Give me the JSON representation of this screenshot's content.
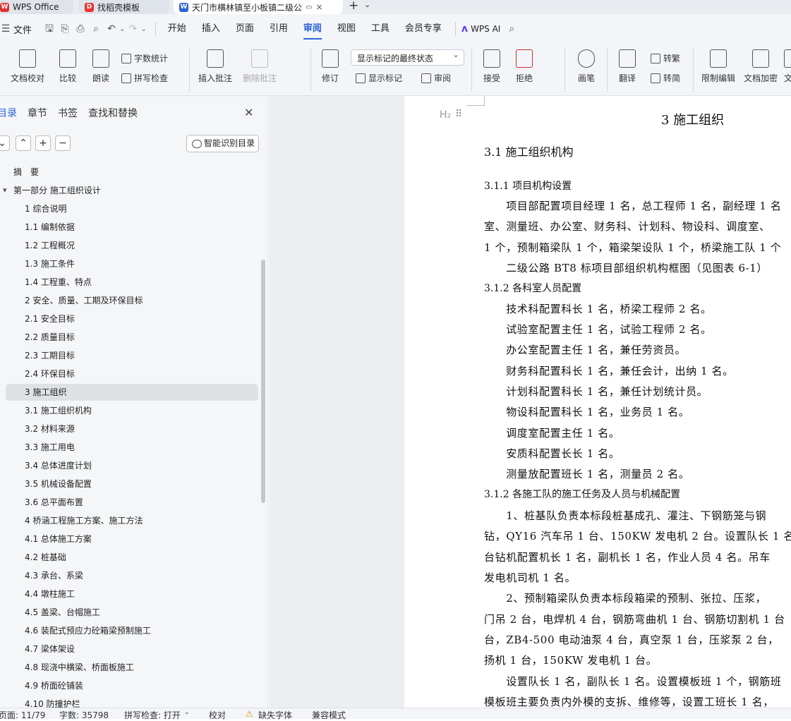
{
  "tabs": [
    {
      "label": "WPS Office"
    },
    {
      "label": "找稻壳模板"
    },
    {
      "label": "天门市横林镇至小板镇二级公"
    }
  ],
  "menu": {
    "file": "文件",
    "items": [
      "开始",
      "插入",
      "页面",
      "引用",
      "审阅",
      "视图",
      "工具",
      "会员专享"
    ],
    "active": "审阅",
    "ai": "WPS AI"
  },
  "ribbon": {
    "doc_check": "文档校对",
    "compare": "比较",
    "read_aloud": "朗读",
    "word_count": "字数统计",
    "spell_check": "拼写检查",
    "insert_comment": "插入批注",
    "delete_comment": "删除批注",
    "revise": "修订",
    "display_state": "显示标记的最终状态",
    "show_marks": "显示标记",
    "review": "审阅",
    "accept": "接受",
    "reject": "拒绝",
    "pen": "画笔",
    "translate": "翻译",
    "to_trad": "转繁",
    "to_simp": "转简",
    "restrict_edit": "限制编辑",
    "encrypt": "文档加密",
    "more": "文"
  },
  "nav": {
    "tabs": [
      "目录",
      "章节",
      "书签",
      "查找和替换"
    ],
    "smart_toc": "智能识别目录",
    "items": [
      {
        "label": "摘　要",
        "level": 0
      },
      {
        "label": "第一部分 施工组织设计",
        "level": 0
      },
      {
        "label": "1 综合说明",
        "level": 1
      },
      {
        "label": "1.1 编制依据",
        "level": 1
      },
      {
        "label": "1.2 工程概况",
        "level": 1
      },
      {
        "label": "1.3 施工条件",
        "level": 1
      },
      {
        "label": "1.4 工程重、特点",
        "level": 1
      },
      {
        "label": "2 安全、质量、工期及环保目标",
        "level": 1
      },
      {
        "label": "2.1 安全目标",
        "level": 1
      },
      {
        "label": "2.2 质量目标",
        "level": 1
      },
      {
        "label": "2.3 工期目标",
        "level": 1
      },
      {
        "label": "2.4 环保目标",
        "level": 1
      },
      {
        "label": "3 施工组织",
        "level": 1
      },
      {
        "label": "3.1 施工组织机构",
        "level": 1
      },
      {
        "label": "3.2 材料来源",
        "level": 1
      },
      {
        "label": "3.3 施工用电",
        "level": 1
      },
      {
        "label": "3.4 总体进度计划",
        "level": 1
      },
      {
        "label": "3.5 机械设备配置",
        "level": 1
      },
      {
        "label": "3.6 总平面布置",
        "level": 1
      },
      {
        "label": "4 桥涵工程施工方案、施工方法",
        "level": 1
      },
      {
        "label": "4.1 总体施工方案",
        "level": 1
      },
      {
        "label": "4.2 桩基础",
        "level": 1
      },
      {
        "label": "4.3 承台、系梁",
        "level": 1
      },
      {
        "label": "4.4 墩柱施工",
        "level": 1
      },
      {
        "label": "4.5 盖梁、台帽施工",
        "level": 1
      },
      {
        "label": "4.6 装配式预应力砼箱梁预制施工",
        "level": 1
      },
      {
        "label": "4.7 梁体架设",
        "level": 1
      },
      {
        "label": "4.8 现浇中横梁、桥面板施工",
        "level": 1
      },
      {
        "label": "4.9 桥面砼铺装",
        "level": 1
      },
      {
        "label": "4.10 防撞护栏",
        "level": 1
      }
    ],
    "selected": "3 施工组织"
  },
  "doc": {
    "heading_marker": "H₂",
    "lines": [
      {
        "text": "3  施工组织",
        "cls": "h1"
      },
      {
        "text": "3.1  施工组织机构",
        "cls": "h2"
      },
      {
        "text": "3.1.1  项目机构设置",
        "cls": "h3"
      },
      {
        "text": "　　项目部配置项目经理 1 名，总工程师 1 名，副经理 1 名",
        "cls": "p"
      },
      {
        "text": "室、测量班、办公室、财务科、计划科、物设科、调度室、",
        "cls": "p"
      },
      {
        "text": "1 个，预制箱梁队 1 个，箱梁架设队 1 个，桥梁施工队 1 个",
        "cls": "p"
      },
      {
        "text": "　　二级公路 BT8 标项目部组织机构框图（见图表 6-1）",
        "cls": "p"
      },
      {
        "text": "3.1.2  各科室人员配置",
        "cls": "h3"
      },
      {
        "text": "　　技术科配置科长 1 名，桥梁工程师 2 名。",
        "cls": "p"
      },
      {
        "text": "　　试验室配置主任 1 名，试验工程师 2 名。",
        "cls": "p"
      },
      {
        "text": "　　办公室配置主任 1 名，兼任劳资员。",
        "cls": "p"
      },
      {
        "text": "　　财务科配置科长 1 名，兼任会计，出纳 1 名。",
        "cls": "p"
      },
      {
        "text": "　　计划科配置科长 1 名，兼任计划统计员。",
        "cls": "p"
      },
      {
        "text": "　　物设科配置科长 1 名，业务员 1 名。",
        "cls": "p"
      },
      {
        "text": "　　调度室配置主任 1 名。",
        "cls": "p"
      },
      {
        "text": "　　安质科配置长长 1 名。",
        "cls": "p"
      },
      {
        "text": "　　测量放配置班长 1 名，测量员 2 名。",
        "cls": "p"
      },
      {
        "text": "3.1.2  各施工队的施工任务及人员与机械配置",
        "cls": "h3"
      },
      {
        "text": "　　1、桩基队负责本标段桩基成孔、灌注、下钢筋笼与钢",
        "cls": "p"
      },
      {
        "text": "钻，QY16 汽车吊 1 台、150KW 发电机 2 台。设置队长 1 名",
        "cls": "p"
      },
      {
        "text": "台钻机配置机长 1 名，副机长 1 名，作业人员 4 名。吊车",
        "cls": "p"
      },
      {
        "text": "发电机司机 1 名。",
        "cls": "p"
      },
      {
        "text": "　　2、预制箱梁队负责本标段箱梁的预制、张拉、压浆，",
        "cls": "p"
      },
      {
        "text": "门吊 2 台，电焊机 4 台，钢筋弯曲机 1 台、钢筋切割机 1 台",
        "cls": "p"
      },
      {
        "text": "台，ZB4-500 电动油泵 4 台，真空泵 1 台，压浆泵 2 台，",
        "cls": "p"
      },
      {
        "text": "扬机 1 台，150KW 发电机 1 台。",
        "cls": "p"
      },
      {
        "text": "　　设置队长 1 名，副队长 1 名。设置模板班 1 个，钢筋班",
        "cls": "p"
      },
      {
        "text": "模板班主要负责内外模的支拆、维修等，设置工班长 1 名，",
        "cls": "p"
      }
    ]
  },
  "status": {
    "page": "页面: 11/79",
    "words": "字数: 35798",
    "spell": "拼写检查: 打开",
    "proof": "校对",
    "missing_font": "缺失字体",
    "compat": "兼容模式"
  }
}
